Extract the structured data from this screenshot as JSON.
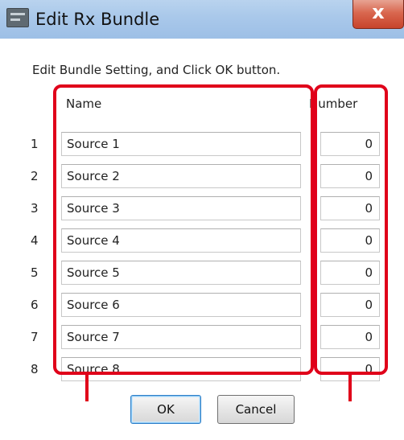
{
  "window": {
    "title": "Edit Rx Bundle",
    "close_label": "x",
    "icon": "app-icon"
  },
  "dialog": {
    "instruction": "Edit Bundle Setting, and Click OK button.",
    "columns": {
      "name": "Name",
      "number": "Number"
    },
    "rows": [
      {
        "index": "1",
        "name": "Source 1",
        "number": "0"
      },
      {
        "index": "2",
        "name": "Source 2",
        "number": "0"
      },
      {
        "index": "3",
        "name": "Source 3",
        "number": "0"
      },
      {
        "index": "4",
        "name": "Source 4",
        "number": "0"
      },
      {
        "index": "5",
        "name": "Source 5",
        "number": "0"
      },
      {
        "index": "6",
        "name": "Source 6",
        "number": "0"
      },
      {
        "index": "7",
        "name": "Source 7",
        "number": "0"
      },
      {
        "index": "8",
        "name": "Source 8",
        "number": "0"
      }
    ],
    "buttons": {
      "ok": "OK",
      "cancel": "Cancel"
    }
  },
  "colors": {
    "highlight": "#e0001a",
    "titlebar": "#a9c8ea",
    "close_button": "#d9674f",
    "ok_border": "#2f7fc8"
  }
}
